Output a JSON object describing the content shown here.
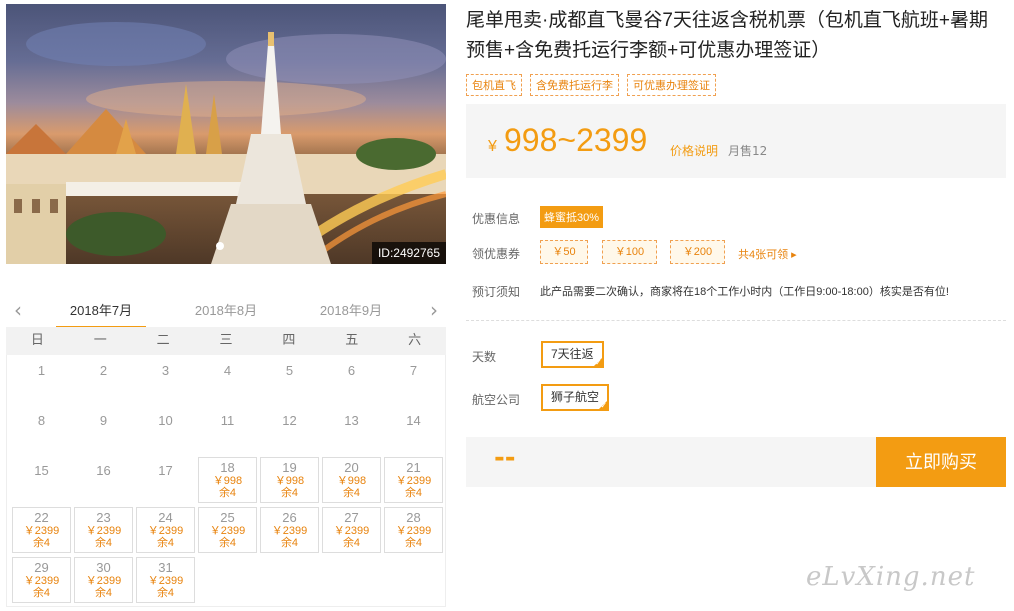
{
  "photo": {
    "id_label": "ID:2492765"
  },
  "calendar": {
    "months": [
      "2018年7月",
      "2018年8月",
      "2018年9月"
    ],
    "weekdays": [
      "日",
      "一",
      "二",
      "三",
      "四",
      "五",
      "六"
    ],
    "days": [
      {
        "day": "1"
      },
      {
        "day": "2"
      },
      {
        "day": "3"
      },
      {
        "day": "4"
      },
      {
        "day": "5"
      },
      {
        "day": "6"
      },
      {
        "day": "7"
      },
      {
        "day": "8"
      },
      {
        "day": "9"
      },
      {
        "day": "10"
      },
      {
        "day": "11"
      },
      {
        "day": "12"
      },
      {
        "day": "13"
      },
      {
        "day": "14"
      },
      {
        "day": "15"
      },
      {
        "day": "16"
      },
      {
        "day": "17"
      },
      {
        "day": "18",
        "price": "￥998",
        "remain": "余4"
      },
      {
        "day": "19",
        "price": "￥998",
        "remain": "余4"
      },
      {
        "day": "20",
        "price": "￥998",
        "remain": "余4"
      },
      {
        "day": "21",
        "price": "￥2399",
        "remain": "余4"
      },
      {
        "day": "22",
        "price": "￥2399",
        "remain": "余4"
      },
      {
        "day": "23",
        "price": "￥2399",
        "remain": "余4"
      },
      {
        "day": "24",
        "price": "￥2399",
        "remain": "余4"
      },
      {
        "day": "25",
        "price": "￥2399",
        "remain": "余4"
      },
      {
        "day": "26",
        "price": "￥2399",
        "remain": "余4"
      },
      {
        "day": "27",
        "price": "￥2399",
        "remain": "余4"
      },
      {
        "day": "28",
        "price": "￥2399",
        "remain": "余4"
      },
      {
        "day": "29",
        "price": "￥2399",
        "remain": "余4"
      },
      {
        "day": "30",
        "price": "￥2399",
        "remain": "余4"
      },
      {
        "day": "31",
        "price": "￥2399",
        "remain": "余4"
      }
    ]
  },
  "product": {
    "title": "尾单甩卖·成都直飞曼谷7天往返含税机票（包机直飞航班+暑期预售+含免费托运行李额+可优惠办理签证）",
    "tags": [
      "包机直飞",
      "含免费托运行李",
      "可优惠办理签证"
    ],
    "currency": "¥",
    "price": "998~2399",
    "price_note": "价格说明",
    "sold": "月售12"
  },
  "promo": {
    "label": "优惠信息",
    "badge": "蜂蜜抵30%",
    "coupon_label": "领优惠券",
    "coupons": [
      "￥50",
      "￥100",
      "￥200"
    ],
    "coupon_more": "共4张可领 ▸",
    "notice_label": "预订须知",
    "notice": "此产品需要二次确认，商家将在18个工作小时内（工作日9:00-18:00）核实是否有位!"
  },
  "options": {
    "days_label": "天数",
    "days_value": "7天往返",
    "airline_label": "航空公司",
    "airline_value": "狮子航空"
  },
  "buy": {
    "total": "--",
    "button": "立即购买"
  },
  "watermark": "eLvXing.net"
}
